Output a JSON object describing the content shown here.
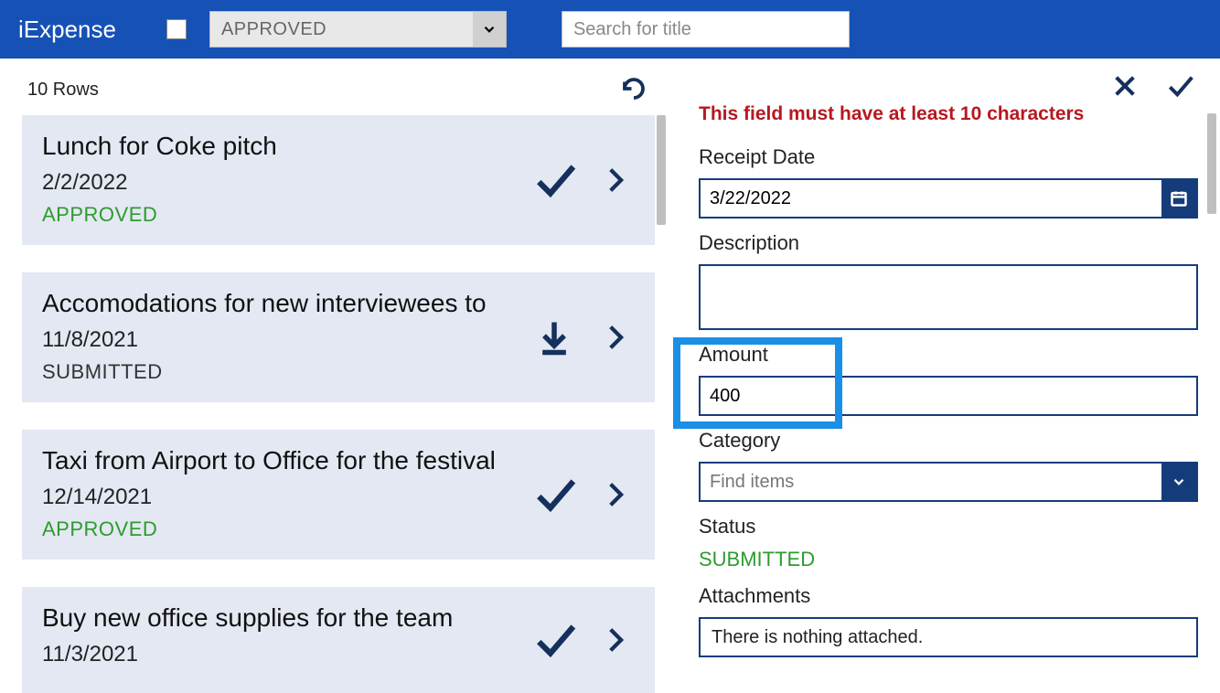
{
  "app_title": "iExpense",
  "filter_value": "APPROVED",
  "search_placeholder": "Search for title",
  "row_count_label": "10 Rows",
  "list": [
    {
      "title": "Lunch for Coke pitch",
      "date": "2/2/2022",
      "status": "APPROVED",
      "status_kind": "approved",
      "icon": "check"
    },
    {
      "title": "Accomodations for new interviewees to",
      "date": "11/8/2021",
      "status": "SUBMITTED",
      "status_kind": "submitted",
      "icon": "download"
    },
    {
      "title": "Taxi from Airport to Office for the festival",
      "date": "12/14/2021",
      "status": "APPROVED",
      "status_kind": "approved",
      "icon": "check"
    },
    {
      "title": "Buy new office supplies for the team",
      "date": "11/3/2021",
      "status": "",
      "status_kind": "approved",
      "icon": "check"
    }
  ],
  "detail": {
    "validation": "This field must have at least 10 characters",
    "labels": {
      "receipt_date": "Receipt Date",
      "description": "Description",
      "amount": "Amount",
      "category": "Category",
      "status": "Status",
      "attachments": "Attachments"
    },
    "receipt_date": "3/22/2022",
    "description": "",
    "amount": "400",
    "category_placeholder": "Find items",
    "status_value": "SUBMITTED",
    "attachments_text": "There is nothing attached."
  }
}
